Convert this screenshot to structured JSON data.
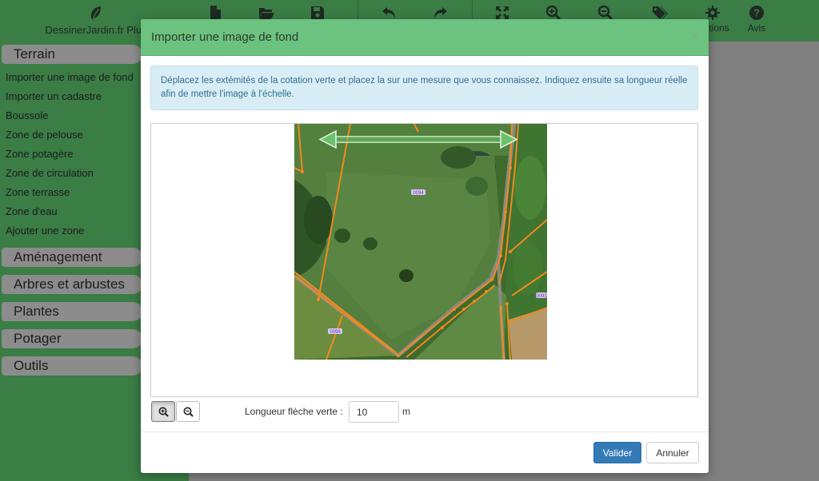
{
  "app": {
    "brand": "DessinerJardin.fr Plus",
    "toolbar": [
      {
        "icon": "new-file-icon"
      },
      {
        "icon": "open-folder-icon"
      },
      {
        "icon": "save-icon"
      },
      {
        "icon": "undo-icon"
      },
      {
        "icon": "redo-icon"
      },
      {
        "icon": "fullscreen-icon"
      },
      {
        "icon": "zoom-in-icon"
      },
      {
        "icon": "zoom-out-icon"
      },
      {
        "icon": "tags-icon"
      },
      {
        "icon": "gear-icon",
        "label": "Options"
      },
      {
        "icon": "question-icon",
        "label": "Avis"
      }
    ],
    "sidebar": {
      "sections": [
        "Terrain",
        "Aménagement",
        "Arbres et arbustes",
        "Plantes",
        "Potager",
        "Outils"
      ],
      "terrain_items": [
        "Importer une image de fond",
        "Importer un cadastre",
        "Boussole",
        "Zone de pelouse",
        "Zone potagère",
        "Zone de circulation",
        "Zone terrasse",
        "Zone d'eau",
        "Ajouter une zone"
      ]
    }
  },
  "modal": {
    "title": "Importer une image de fond",
    "close": "×",
    "info": "Déplacez les extémités de la cotation verte et placez la sur une mesure que vous connaissez. Indiquez ensuite sa longueur réelle afin de mettre l'image à l'échelle.",
    "parcel_labels": [
      "0094",
      "0096",
      "0093"
    ],
    "length_label": "Longueur flèche verte :",
    "length_value": "10",
    "length_unit": "m",
    "ok_label": "Valider",
    "cancel_label": "Annuler"
  },
  "colors": {
    "header_green": "#6cc27f",
    "app_green": "#3a7d45",
    "primary_blue": "#337ab7",
    "info_bg": "#d9edf7",
    "cadastre_orange": "#f08a1c"
  }
}
